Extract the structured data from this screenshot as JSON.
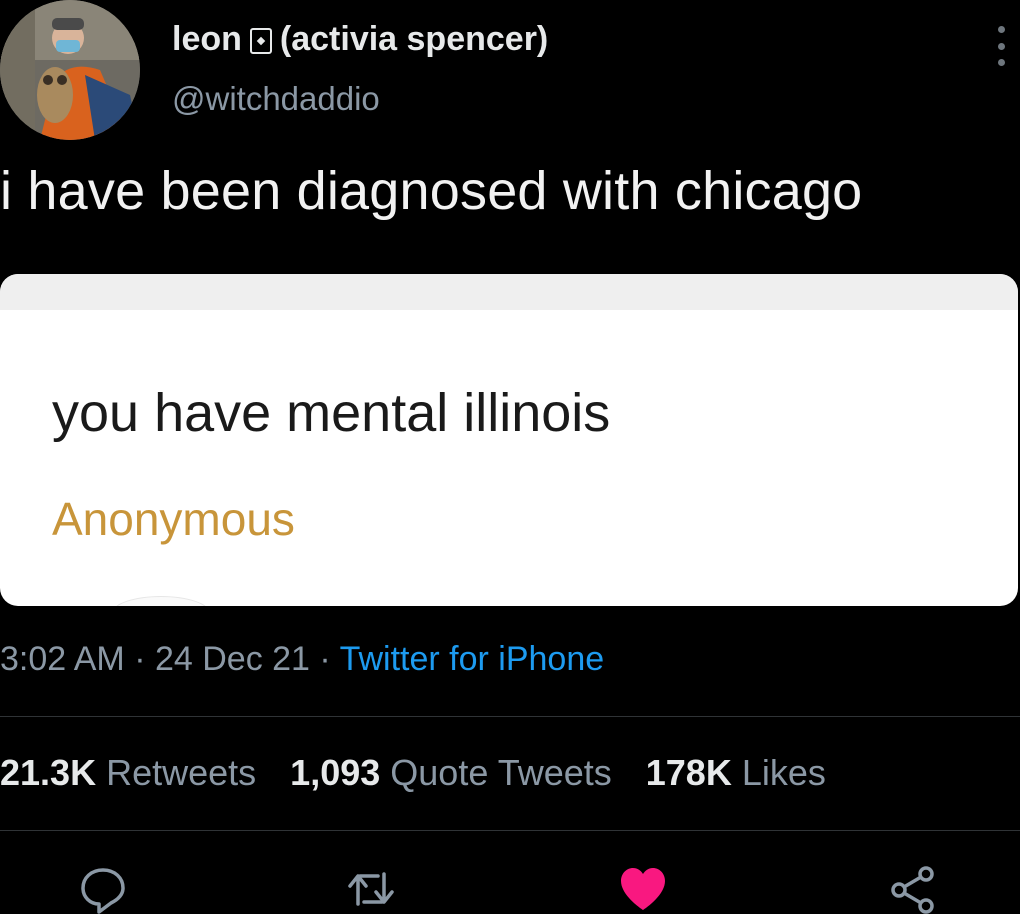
{
  "author": {
    "display_name": "leon",
    "display_name_suffix": "(activia spencer)",
    "handle": "@witchdaddio"
  },
  "tweet": {
    "text": "i have been diagnosed with chicago"
  },
  "media_card": {
    "question": "you have mental illinois",
    "from": "Anonymous"
  },
  "meta": {
    "time": "3:02 AM",
    "sep1": " · ",
    "date": "24 Dec 21",
    "sep2": " · ",
    "source": "Twitter for iPhone"
  },
  "stats": {
    "retweets_count": "21.3K",
    "retweets_label": "Retweets",
    "quotes_count": "1,093",
    "quotes_label": "Quote Tweets",
    "likes_count": "178K",
    "likes_label": "Likes"
  },
  "colors": {
    "background": "#000000",
    "link_blue": "#1d9bf0",
    "muted_gray": "#8b98a5",
    "like_pink": "#f91880",
    "anonymous_gold": "#c8953a"
  },
  "icons": [
    "more-icon",
    "reply-icon",
    "retweet-icon",
    "like-icon",
    "share-icon",
    "id-card-icon"
  ]
}
